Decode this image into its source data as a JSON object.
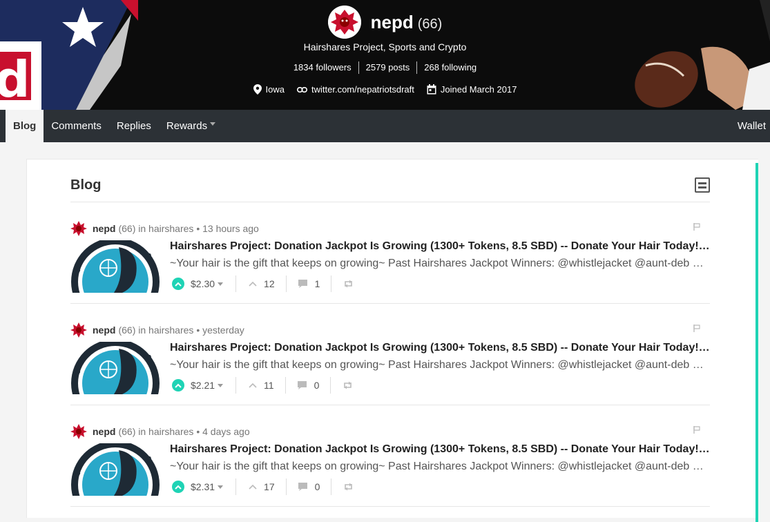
{
  "profile": {
    "name": "nepd",
    "reputation": "(66)",
    "tagline": "Hairshares Project, Sports and Crypto",
    "followers": "1834 followers",
    "posts": "2579 posts",
    "following": "268 following",
    "location": "Iowa",
    "website": "twitter.com/nepatriotsdraft",
    "joined": "Joined March 2017"
  },
  "nav": {
    "tabs": [
      "Blog",
      "Comments",
      "Replies",
      "Rewards"
    ],
    "wallet": "Wallet"
  },
  "main": {
    "title": "Blog"
  },
  "posts": [
    {
      "author": "nepd",
      "rep": "(66)",
      "in": "in",
      "community": "hairshares",
      "time": "• 13 hours ago",
      "title": "Hairshares Project: Donation Jackpot Is Growing (1300+ Tokens, 8.5 SBD) -- Donate Your Hair Today!…",
      "body": "~Your hair is the gift that keeps on growing~ Past Hairshares Jackpot Winners: @whistlejacket @aunt-deb …",
      "payout": "$2.30",
      "votes": "12",
      "comments": "1"
    },
    {
      "author": "nepd",
      "rep": "(66)",
      "in": "in",
      "community": "hairshares",
      "time": "• yesterday",
      "title": "Hairshares Project: Donation Jackpot Is Growing (1300+ Tokens, 8.5 SBD) -- Donate Your Hair Today!…",
      "body": "~Your hair is the gift that keeps on growing~ Past Hairshares Jackpot Winners: @whistlejacket @aunt-deb …",
      "payout": "$2.21",
      "votes": "11",
      "comments": "0"
    },
    {
      "author": "nepd",
      "rep": "(66)",
      "in": "in",
      "community": "hairshares",
      "time": "• 4 days ago",
      "title": "Hairshares Project: Donation Jackpot Is Growing (1300+ Tokens, 8.5 SBD) -- Donate Your Hair Today!…",
      "body": "~Your hair is the gift that keeps on growing~ Past Hairshares Jackpot Winners: @whistlejacket @aunt-deb …",
      "payout": "$2.31",
      "votes": "17",
      "comments": "0"
    }
  ],
  "colors": {
    "accent": "#1fd3b5",
    "nav_bg": "#2c3136",
    "hero_bg": "#0c0c0c"
  },
  "icons": {
    "location": "map-pin-icon",
    "link": "link-icon",
    "calendar": "calendar-icon",
    "upvote": "upvote-chevron-icon",
    "votes": "caret-up-icon",
    "comments": "comment-bubble-icon",
    "reblog": "reblog-icon",
    "flag": "flag-icon",
    "layout": "layout-toggle-icon"
  }
}
